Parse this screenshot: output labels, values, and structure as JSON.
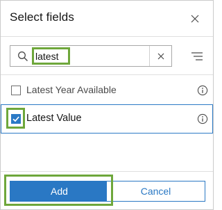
{
  "dialog": {
    "title": "Select fields"
  },
  "search": {
    "value": "latest",
    "clear_icon": "close-icon",
    "search_icon": "search-icon"
  },
  "filter": {
    "icon": "filter-list-icon"
  },
  "fields": [
    {
      "label": "Latest Year Available",
      "checked": false
    },
    {
      "label": "Latest Value",
      "checked": true
    }
  ],
  "footer": {
    "add_label": "Add",
    "cancel_label": "Cancel"
  },
  "colors": {
    "accent": "#2a78c4",
    "highlight": "#6ea73b",
    "text": "#151515",
    "border": "#cacaca"
  }
}
